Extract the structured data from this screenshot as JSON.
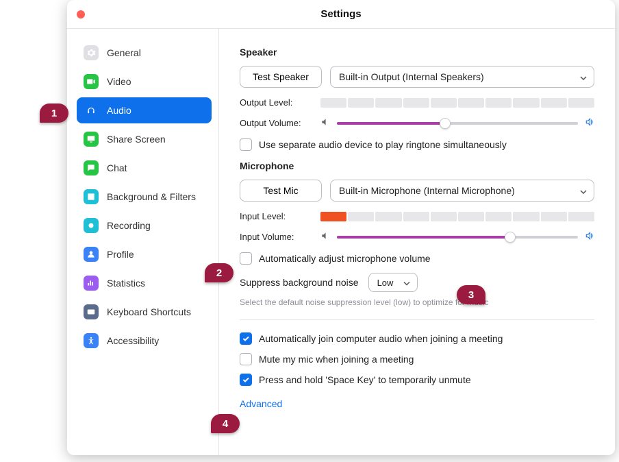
{
  "window": {
    "title": "Settings"
  },
  "sidebar": {
    "items": [
      {
        "label": "General",
        "icon_bg": "#e0e0e4",
        "icon_fg": "#fff"
      },
      {
        "label": "Video",
        "icon_bg": "#28c445",
        "icon_fg": "#fff"
      },
      {
        "label": "Audio",
        "icon_bg": "#0e71eb",
        "icon_fg": "#fff",
        "active": true
      },
      {
        "label": "Share Screen",
        "icon_bg": "#28c445",
        "icon_fg": "#fff"
      },
      {
        "label": "Chat",
        "icon_bg": "#28c445",
        "icon_fg": "#fff"
      },
      {
        "label": "Background & Filters",
        "icon_bg": "#1fc0d6",
        "icon_fg": "#fff"
      },
      {
        "label": "Recording",
        "icon_bg": "#1fc0d6",
        "icon_fg": "#fff"
      },
      {
        "label": "Profile",
        "icon_bg": "#3b82f6",
        "icon_fg": "#fff"
      },
      {
        "label": "Statistics",
        "icon_bg": "#9c5cf0",
        "icon_fg": "#fff"
      },
      {
        "label": "Keyboard Shortcuts",
        "icon_bg": "#5b6b8c",
        "icon_fg": "#fff"
      },
      {
        "label": "Accessibility",
        "icon_bg": "#3b82f6",
        "icon_fg": "#fff"
      }
    ]
  },
  "speaker": {
    "section": "Speaker",
    "test_btn": "Test Speaker",
    "device": "Built-in Output (Internal Speakers)",
    "output_level_label": "Output Level:",
    "output_volume_label": "Output Volume:",
    "output_volume_pct": 45,
    "separate_device": "Use separate audio device to play ringtone simultaneously",
    "separate_device_checked": false
  },
  "mic": {
    "section": "Microphone",
    "test_btn": "Test Mic",
    "device": "Built-in Microphone (Internal Microphone)",
    "input_level_label": "Input Level:",
    "input_level_segments_filled": 1,
    "input_volume_label": "Input Volume:",
    "input_volume_pct": 72,
    "auto_adjust": "Automatically adjust microphone volume",
    "auto_adjust_checked": false,
    "suppress_label": "Suppress background noise",
    "suppress_value": "Low",
    "suppress_hint": "Select the default noise suppression level (low) to optimize for music"
  },
  "options": {
    "auto_join": "Automatically join computer audio when joining a meeting",
    "auto_join_checked": true,
    "mute_on_join": "Mute my mic when joining a meeting",
    "mute_on_join_checked": false,
    "space_unmute": "Press and hold 'Space Key' to temporarily unmute",
    "space_unmute_checked": true
  },
  "advanced_label": "Advanced",
  "markers": {
    "1": "1",
    "2": "2",
    "3": "3",
    "4": "4"
  }
}
